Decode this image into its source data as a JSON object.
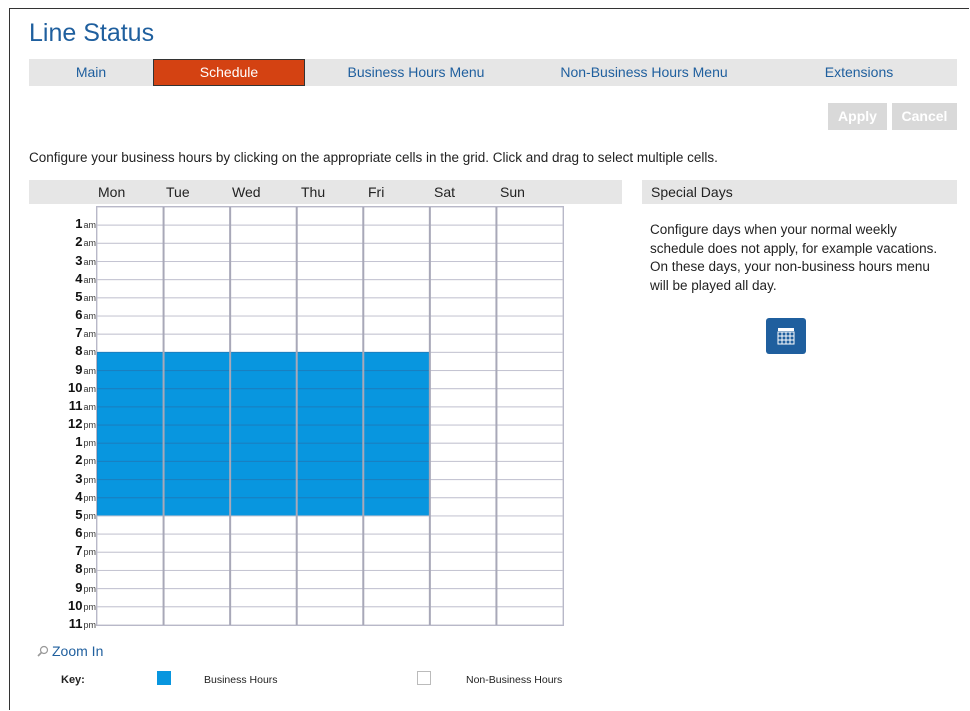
{
  "page_title": "Line Status",
  "tabs": [
    {
      "label": "Main"
    },
    {
      "label": "Schedule"
    },
    {
      "label": "Business Hours Menu"
    },
    {
      "label": "Non-Business Hours Menu"
    },
    {
      "label": "Extensions"
    }
  ],
  "actions": {
    "apply": "Apply",
    "cancel": "Cancel"
  },
  "instructions": "Configure your business hours by clicking on the appropriate cells in the grid. Click and drag to select multiple cells.",
  "days": [
    "Mon",
    "Tue",
    "Wed",
    "Thu",
    "Fri",
    "Sat",
    "Sun"
  ],
  "hours": [
    {
      "h": "1",
      "p": "am"
    },
    {
      "h": "2",
      "p": "am"
    },
    {
      "h": "3",
      "p": "am"
    },
    {
      "h": "4",
      "p": "am"
    },
    {
      "h": "5",
      "p": "am"
    },
    {
      "h": "6",
      "p": "am"
    },
    {
      "h": "7",
      "p": "am"
    },
    {
      "h": "8",
      "p": "am"
    },
    {
      "h": "9",
      "p": "am"
    },
    {
      "h": "10",
      "p": "am"
    },
    {
      "h": "11",
      "p": "am"
    },
    {
      "h": "12",
      "p": "pm"
    },
    {
      "h": "1",
      "p": "pm"
    },
    {
      "h": "2",
      "p": "pm"
    },
    {
      "h": "3",
      "p": "pm"
    },
    {
      "h": "4",
      "p": "pm"
    },
    {
      "h": "5",
      "p": "pm"
    },
    {
      "h": "6",
      "p": "pm"
    },
    {
      "h": "7",
      "p": "pm"
    },
    {
      "h": "8",
      "p": "pm"
    },
    {
      "h": "9",
      "p": "pm"
    },
    {
      "h": "10",
      "p": "pm"
    },
    {
      "h": "11",
      "p": "pm"
    }
  ],
  "schedule": {
    "business_days": [
      "Mon",
      "Tue",
      "Wed",
      "Thu",
      "Fri"
    ],
    "business_start": "9 am",
    "business_end": "6 pm"
  },
  "special_days": {
    "title": "Special Days",
    "description": "Configure days when your normal weekly schedule does not apply, for example vacations. On these days, your non-business hours menu will be played all day."
  },
  "zoom_label": "Zoom In",
  "key": {
    "label": "Key:",
    "business": "Business Hours",
    "non_business": "Non-Business Hours"
  },
  "colors": {
    "business": "#0896df",
    "active_tab": "#d44212",
    "link": "#1f5f9e",
    "disabled_button": "#d9d9d9"
  },
  "icons": {
    "calendar_button": "calendar-icon",
    "zoom": "magnifier-icon"
  }
}
